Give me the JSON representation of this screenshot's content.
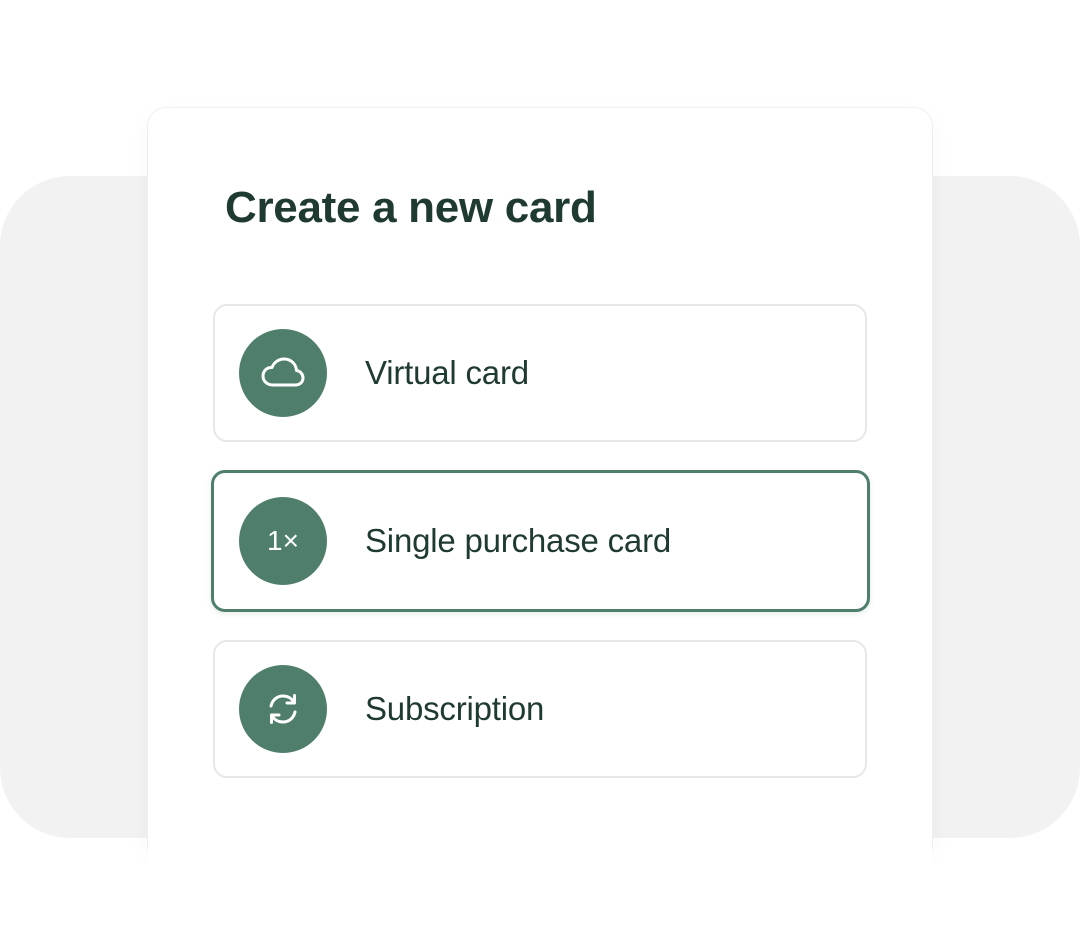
{
  "dialog": {
    "title": "Create a new card",
    "options": [
      {
        "label": "Virtual card",
        "icon": "cloud-icon",
        "selected": false
      },
      {
        "label": "Single purchase card",
        "icon": "one-times-icon",
        "icon_text": "1×",
        "selected": true
      },
      {
        "label": "Subscription",
        "icon": "refresh-icon",
        "selected": false
      }
    ]
  },
  "colors": {
    "accent": "#4f7f6b",
    "title": "#1f3a30",
    "backdrop": "#f2f2f2"
  }
}
